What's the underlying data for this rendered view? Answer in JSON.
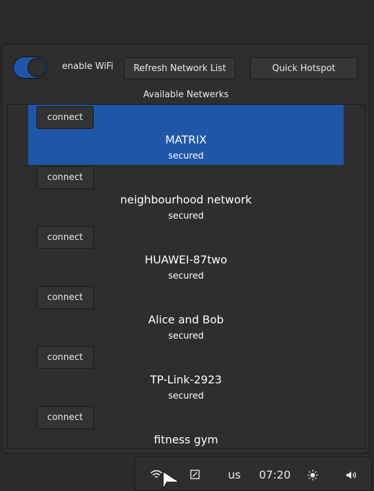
{
  "controls": {
    "wifi_toggle_on": true,
    "enable_wifi_label": "enable WiFi",
    "refresh_label": "Refresh Network List",
    "hotspot_label": "Quick Hotspot"
  },
  "available_title": "Available Netwerks",
  "networks": [
    {
      "connect_label": "connect",
      "ssid": "MATRIX",
      "security": "secured",
      "selected": true
    },
    {
      "connect_label": "connect",
      "ssid": "neighbourhood network",
      "security": "secured",
      "selected": false
    },
    {
      "connect_label": "connect",
      "ssid": "HUAWEI-87two",
      "security": "secured",
      "selected": false
    },
    {
      "connect_label": "connect",
      "ssid": "Alice and Bob",
      "security": "secured",
      "selected": false
    },
    {
      "connect_label": "connect",
      "ssid": "TP-Link-2923",
      "security": "secured",
      "selected": false
    },
    {
      "connect_label": "connect",
      "ssid": "fitness gym",
      "security": "",
      "selected": false
    }
  ],
  "taskbar": {
    "keyboard_layout": "us",
    "clock": "07:20"
  },
  "colors": {
    "accent": "#1f56a8",
    "background": "#2b2b2b",
    "panel": "#2e2e2e"
  }
}
